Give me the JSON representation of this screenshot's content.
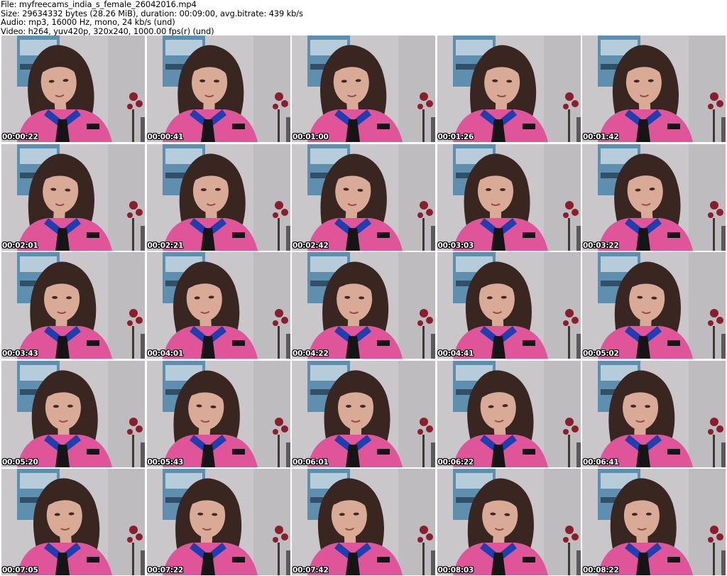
{
  "header": {
    "file_line": "File: myfreecams_india_s_female_26042016.mp4",
    "size_line": "Size: 29634332 bytes (28.26 MiB), duration: 00:09:00, avg.bitrate: 439 kb/s",
    "audio_line": "Audio: mp3, 16000 Hz, mono, 24 kb/s (und)",
    "video_line": "Video: h264, yuv420p, 320x240, 1000.00 fps(r) (und)"
  },
  "thumbnails": [
    {
      "timestamp": "00:00:22"
    },
    {
      "timestamp": "00:00:41"
    },
    {
      "timestamp": "00:01:00"
    },
    {
      "timestamp": "00:01:26"
    },
    {
      "timestamp": "00:01:42"
    },
    {
      "timestamp": "00:02:01"
    },
    {
      "timestamp": "00:02:21"
    },
    {
      "timestamp": "00:02:42"
    },
    {
      "timestamp": "00:03:03"
    },
    {
      "timestamp": "00:03:22"
    },
    {
      "timestamp": "00:03:43"
    },
    {
      "timestamp": "00:04:01"
    },
    {
      "timestamp": "00:04:22"
    },
    {
      "timestamp": "00:04:41"
    },
    {
      "timestamp": "00:05:02"
    },
    {
      "timestamp": "00:05:20"
    },
    {
      "timestamp": "00:05:43"
    },
    {
      "timestamp": "00:06:01"
    },
    {
      "timestamp": "00:06:22"
    },
    {
      "timestamp": "00:06:41"
    },
    {
      "timestamp": "00:07:05"
    },
    {
      "timestamp": "00:07:22"
    },
    {
      "timestamp": "00:07:42"
    },
    {
      "timestamp": "00:08:03"
    },
    {
      "timestamp": "00:08:22"
    }
  ],
  "colors": {
    "wall": "#c9c7c9",
    "poster": "#5f8fae",
    "hair": "#3a2620",
    "skin": "#d9ab97",
    "shirt": "#e0559a",
    "collar": "#1f3fb0",
    "bow": "#151515",
    "roses": "#8a1e2a"
  }
}
